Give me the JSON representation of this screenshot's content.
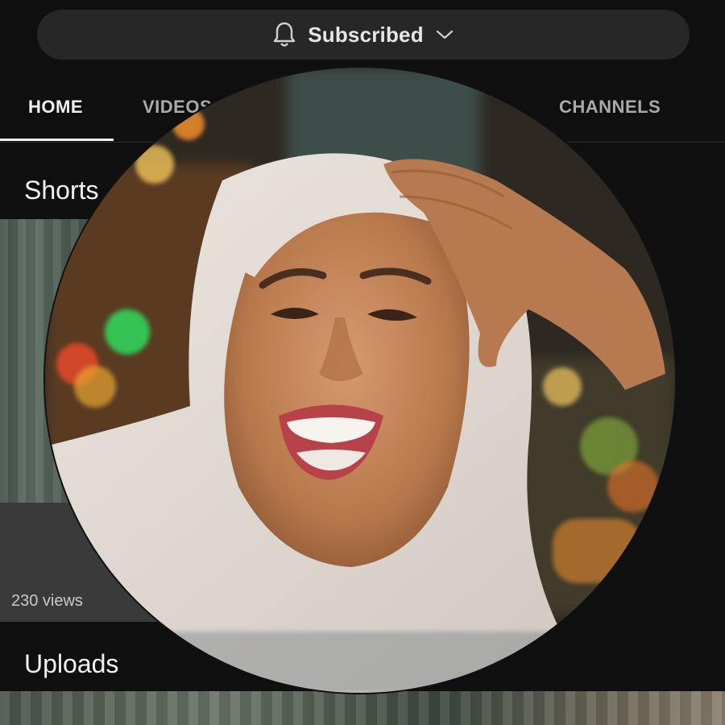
{
  "subscribe": {
    "label": "Subscribed",
    "icon": "bell-icon",
    "dropdown_icon": "chevron-down-icon"
  },
  "tabs": [
    {
      "label": "HOME",
      "active": true
    },
    {
      "label": "VIDEOS",
      "active": false
    },
    {
      "label": "CHANNELS",
      "active": false
    }
  ],
  "sections": {
    "shorts": {
      "title": "Shorts",
      "items": [
        {
          "views": "230 views"
        }
      ]
    },
    "uploads": {
      "title": "Uploads"
    }
  },
  "colors": {
    "background": "#0f0f0f",
    "pill": "#272727",
    "text": "#f1f1f1",
    "muted": "#aaaaaa"
  }
}
